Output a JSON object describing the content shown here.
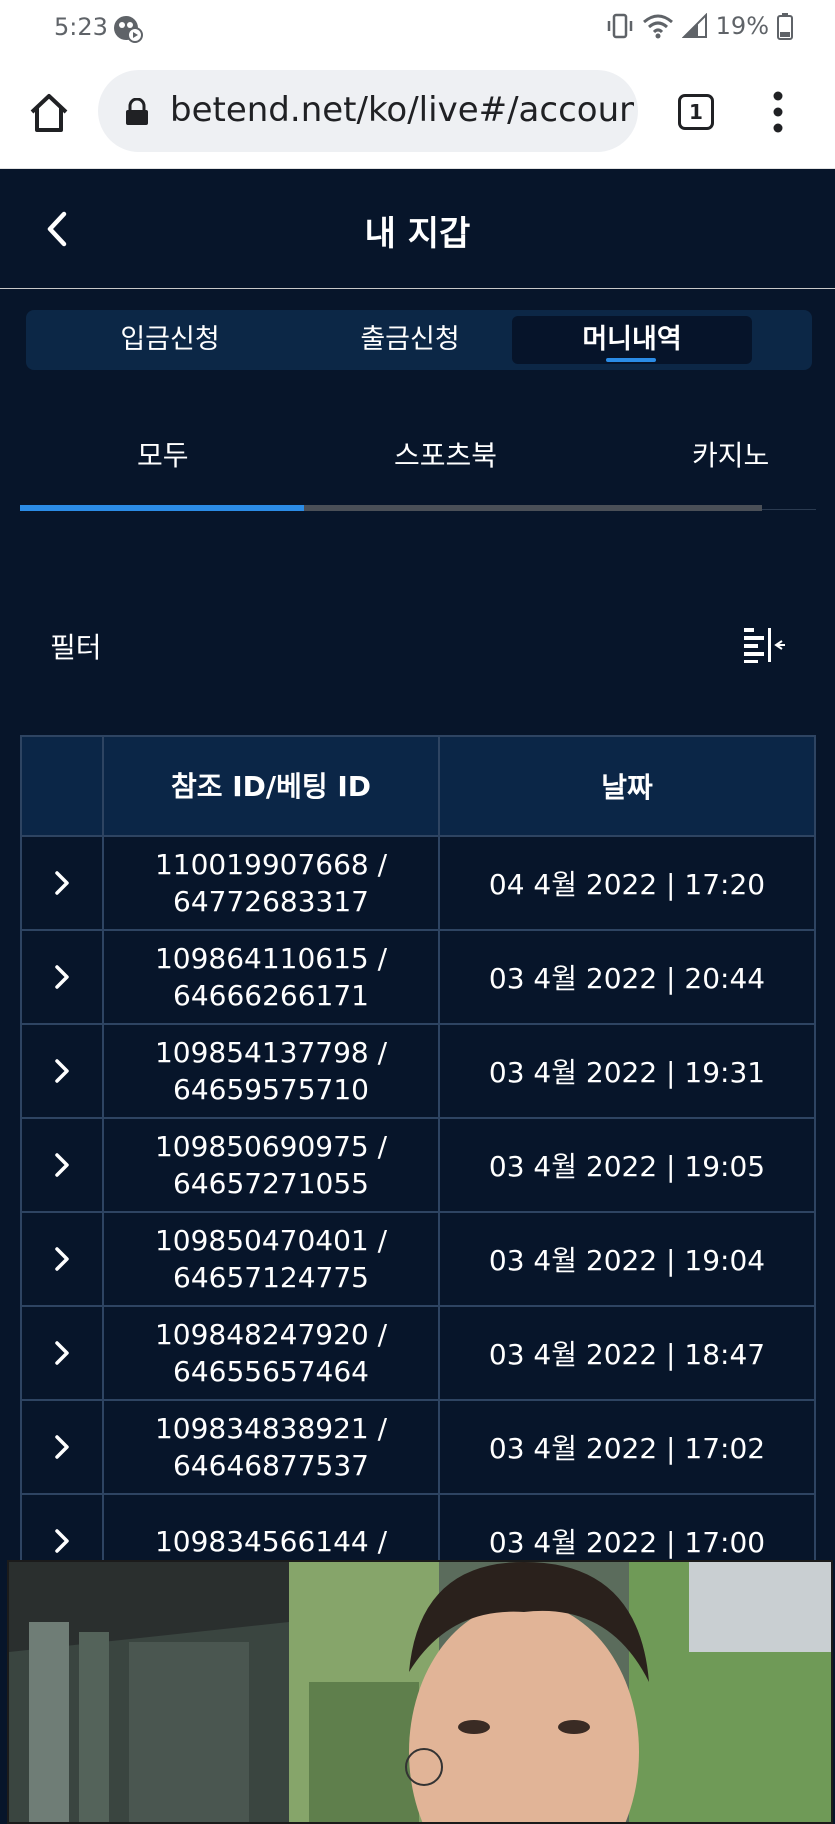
{
  "status_bar": {
    "time": "5:23",
    "battery": "19%"
  },
  "browser": {
    "url": "betend.net/ko/live#/account/",
    "tab_count": "1"
  },
  "header": {
    "title": "내 지갑"
  },
  "main_tabs": [
    {
      "label": "입금신청",
      "active": false
    },
    {
      "label": "출금신청",
      "active": false
    },
    {
      "label": "머니내역",
      "active": true
    }
  ],
  "sub_tabs": [
    {
      "label": "모두",
      "active": true
    },
    {
      "label": "스포츠북",
      "active": false
    },
    {
      "label": "카지노",
      "active": false
    }
  ],
  "filter": {
    "label": "필터"
  },
  "table": {
    "headers": [
      "",
      "참조 ID/베팅 ID",
      "날짜"
    ],
    "rows": [
      {
        "ref_id": "110019907668 /",
        "bet_id": "64772683317",
        "date": "04 4월 2022 | 17:20"
      },
      {
        "ref_id": "109864110615 /",
        "bet_id": "64666266171",
        "date": "03 4월 2022 | 20:44"
      },
      {
        "ref_id": "109854137798 /",
        "bet_id": "64659575710",
        "date": "03 4월 2022 | 19:31"
      },
      {
        "ref_id": "109850690975 /",
        "bet_id": "64657271055",
        "date": "03 4월 2022 | 19:05"
      },
      {
        "ref_id": "109850470401 /",
        "bet_id": "64657124775",
        "date": "03 4월 2022 | 19:04"
      },
      {
        "ref_id": "109848247920 /",
        "bet_id": "64655657464",
        "date": "03 4월 2022 | 18:47"
      },
      {
        "ref_id": "109834838921 /",
        "bet_id": "64646877537",
        "date": "03 4월 2022 | 17:02"
      },
      {
        "ref_id": "109834566144 /",
        "bet_id": "",
        "date": "03 4월 2022 | 17:00"
      }
    ]
  },
  "colors": {
    "background": "#07152a",
    "header_cell": "#0b2647",
    "accent": "#2b8ce6",
    "tab_bar": "#0c2746"
  }
}
